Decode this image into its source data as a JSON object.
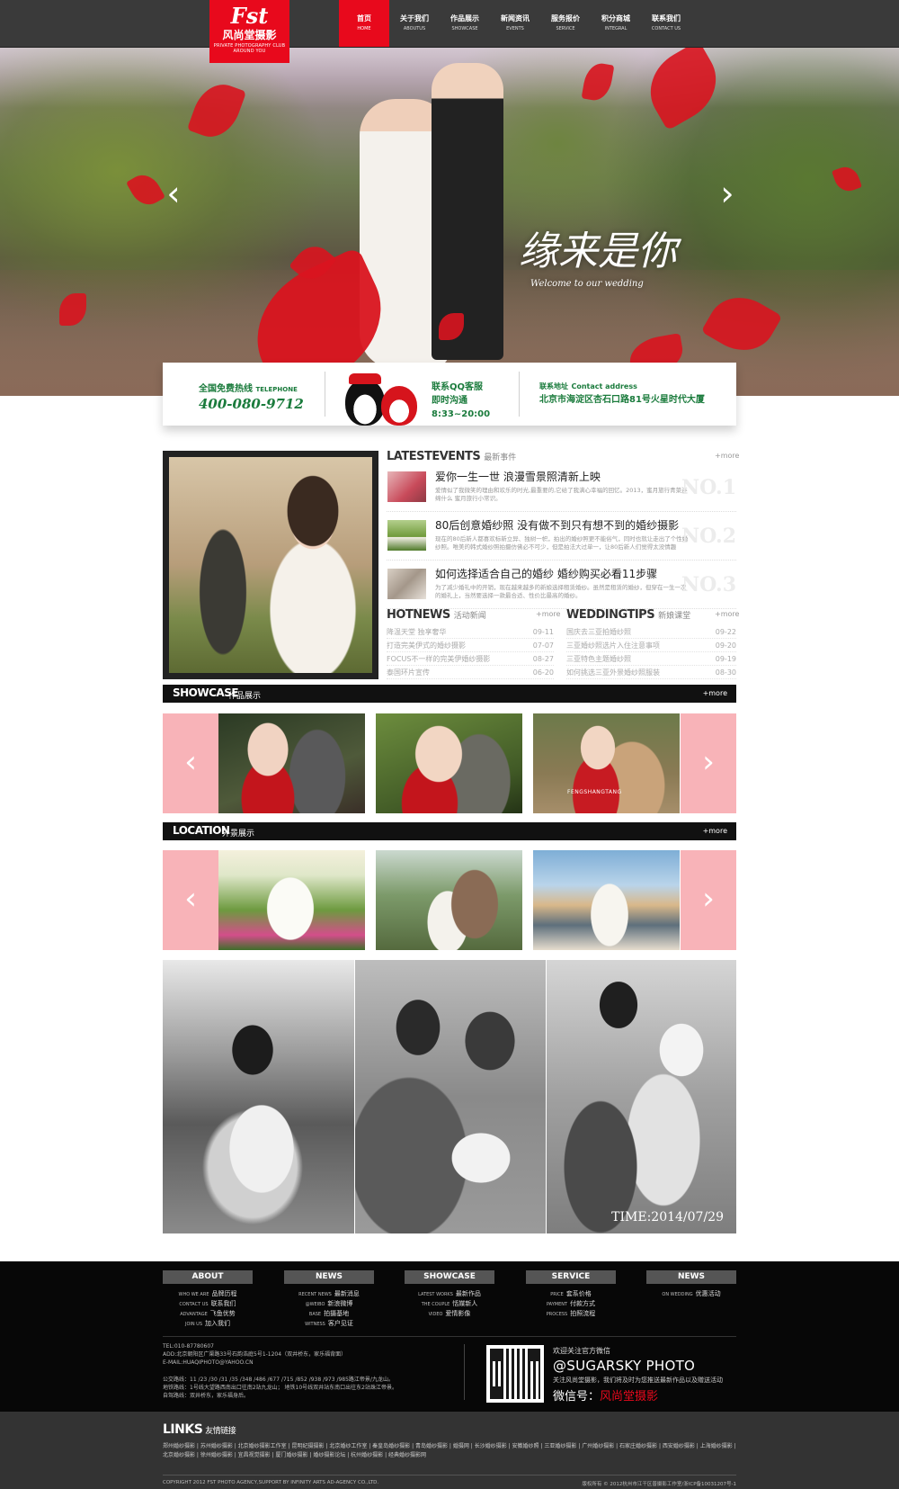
{
  "brand": {
    "logo_script": "Fst",
    "logo_name": "风尚堂摄影",
    "logo_tagline": "PRIVATE PHOTOGRAPHY CLUB AROUND YOU"
  },
  "nav": [
    {
      "cn": "首页",
      "en": "HOME"
    },
    {
      "cn": "关于我们",
      "en": "ABOUTUS"
    },
    {
      "cn": "作品展示",
      "en": "SHOWCASE"
    },
    {
      "cn": "新闻资讯",
      "en": "EVENTS"
    },
    {
      "cn": "服务报价",
      "en": "SERVICE"
    },
    {
      "cn": "积分商城",
      "en": "INTEGRAL"
    },
    {
      "cn": "联系我们",
      "en": "CONTACT US"
    }
  ],
  "hero": {
    "script_title": "缘来是你",
    "script_sub": "Welcome to our wedding",
    "prev": "‹",
    "next": "›"
  },
  "contact": {
    "hotline_label": "全国免费热线",
    "hotline_en": "TELEPHONE",
    "phone": "400-080-9712",
    "qq_label": "联系QQ客服",
    "qq_hours": "即时沟通8:33~20:00",
    "addr_label": "联系地址",
    "addr_en": "Contact address",
    "address": "北京市海淀区杏石口路81号火星时代大厦"
  },
  "events": {
    "head_en": "LATESTEVENTS",
    "head_cn": "最新事件",
    "more": "+more",
    "items": [
      {
        "title": "爱你一生一世 浪漫雪景照清新上映",
        "desc": "爱情似了我微笑的理由和欢乐的时光,最重要的,它给了我满心幸福的回忆。2013，蜜月旅行青菜连绵什么 蜜月旅行小常识。",
        "no": "NO.1"
      },
      {
        "title": "80后创意婚纱照 没有做不到只有想不到的婚纱摄影",
        "desc": "现在的80后新人都喜欢标新立异、独树一帜，拍出的婚纱照更不能俗气，同时也就让走出了个性婚纱照。唯美的韩式婚纱照拍摄仿佛必不可少，但是拍法大过单一，让80后新人们觉得太没情趣",
        "no": "NO.2"
      },
      {
        "title": "如何选择适合自己的婚纱 婚纱购买必看11步骤",
        "desc": "为了减少婚礼中的开销，现在越来越多的新娘选择租赁婚纱。虽然是租赁的婚纱，但穿在一生一次的婚礼上，当然要选择一款最合适、性价比最高的婚纱。",
        "no": "NO.3"
      }
    ]
  },
  "hotnews": {
    "head_en": "HOTNEWS",
    "head_cn": "活动新闻",
    "more": "+more",
    "rows": [
      {
        "t": "降温天堂 独享奢华",
        "d": "09-11"
      },
      {
        "t": "打造完美伊式的婚纱摄影",
        "d": "07-07"
      },
      {
        "t": "FOCUS不一样的完美伊婚纱摄影",
        "d": "08-27"
      },
      {
        "t": "泰国环片宣传",
        "d": "06-20"
      }
    ]
  },
  "tips": {
    "head_en": "WEDDINGTIPS",
    "head_cn": "新娘课堂",
    "more": "+more",
    "rows": [
      {
        "t": "国庆去三亚拍婚纱照",
        "d": "09-22"
      },
      {
        "t": "三亚婚纱照选片入住注意事项",
        "d": "09-20"
      },
      {
        "t": "三亚特色主题婚纱照",
        "d": "09-19"
      },
      {
        "t": "如何挑选三亚外景婚纱照服装",
        "d": "08-30"
      }
    ]
  },
  "showcase": {
    "en": "SHOWCASE",
    "cn": "作品展示",
    "more": "+more",
    "prev": "‹",
    "next": "›",
    "photo2_caption": "FENGSHANGTANG"
  },
  "location": {
    "en": "LOCATION",
    "cn": "外景展示",
    "more": "+more",
    "prev": "‹",
    "next": "›"
  },
  "bw_time": "TIME:2014/07/29",
  "footer": {
    "cols": [
      {
        "head": "ABOUT",
        "items": [
          {
            "e": "WHO WE ARE",
            "c": "品牌历程"
          },
          {
            "e": "CONTACT US",
            "c": "联系我们"
          },
          {
            "e": "ADVANTAGE",
            "c": "飞鱼优势"
          },
          {
            "e": "JOIN US",
            "c": "加入我们"
          }
        ]
      },
      {
        "head": "NEWS",
        "items": [
          {
            "e": "RECENT NEWS",
            "c": "最新消息"
          },
          {
            "e": "@WEIBO",
            "c": "新浪微博"
          },
          {
            "e": "BASE",
            "c": "拍摄基地"
          },
          {
            "e": "WITNESS",
            "c": "客户见证"
          }
        ]
      },
      {
        "head": "SHOWCASE",
        "items": [
          {
            "e": "LATEST WORKS",
            "c": "最新作品"
          },
          {
            "e": "THE COUPLE",
            "c": "恬媒新人"
          },
          {
            "e": "VIDEO",
            "c": "爱情影像"
          }
        ]
      },
      {
        "head": "SERVICE",
        "items": [
          {
            "e": "PRICE",
            "c": "套系价格"
          },
          {
            "e": "PAYMENT",
            "c": "付款方式"
          },
          {
            "e": "PROCESS",
            "c": "拍照流程"
          }
        ]
      },
      {
        "head": "NEWS",
        "items": [
          {
            "e": "ON WEDDING",
            "c": "优惠活动"
          }
        ]
      }
    ],
    "tel": "TEL:010-87780607",
    "add": "ADD:北京朝阳区广渠路33号石韵浩庭5号1-1204（双井桥东，家乐福背面）",
    "email": "E-MAIL:HUAQIPHOTO@YAHOO.CN",
    "bus1": "公交路线：11 /23 /30 /31 /35 /348 /486 /677 /715 /852 /938 /973 /985路江帝景/九龙山。",
    "bus2": "地铁路线：1号线大望路西南出口往南2站九龙山； 地铁10号线双井站东南口出往东2站珠江帝景。",
    "bus3": "自驾路线：双井桥东，家乐福身后。",
    "wx_a": "欢迎关注官方微信",
    "wx_b": "@SUGARSKY PHOTO",
    "wx_c": "关注风尚堂摄影，我们将及时为您推送最新作品以及赠送活动",
    "wx_d_label": "微信号：",
    "wx_d_name": "风尚堂摄影",
    "links_title": "LINKS",
    "links_cn": "友情链接",
    "links": "郑州婚纱摄影 | 苏州婚纱摄影 | 北京婚纱摄影工作室 | 昆明纪摄摄影 | 北京婚纱工作室 | 秦皇岛婚纱摄影 | 青岛婚纱摄影 | 婚摄网 | 长沙婚纱摄影 | 安徽婚纱照 | 三亚婚纱摄影 | 广州婚纱摄影 | 石家庄婚纱摄影 | 西安婚纱摄影 | 上海婚纱摄影 | 北京婚纱摄影 | 徐州婚纱摄影 | 宜昌视觉摄影 | 厦门婚纱摄影 | 婚纱摄影论坛 | 杭州婚纱摄影 | 经典婚纱摄影网",
    "copy_left": "COPYRIGHT 2012 FST PHOTO AGENCY,SUPPORT BY INFINITY ARTS AD-AGENCY CO.,LTD.",
    "copy_right": "版权所有 © 2012杭州市江干区普摄影工作室/浙ICP备10031207号-1"
  }
}
